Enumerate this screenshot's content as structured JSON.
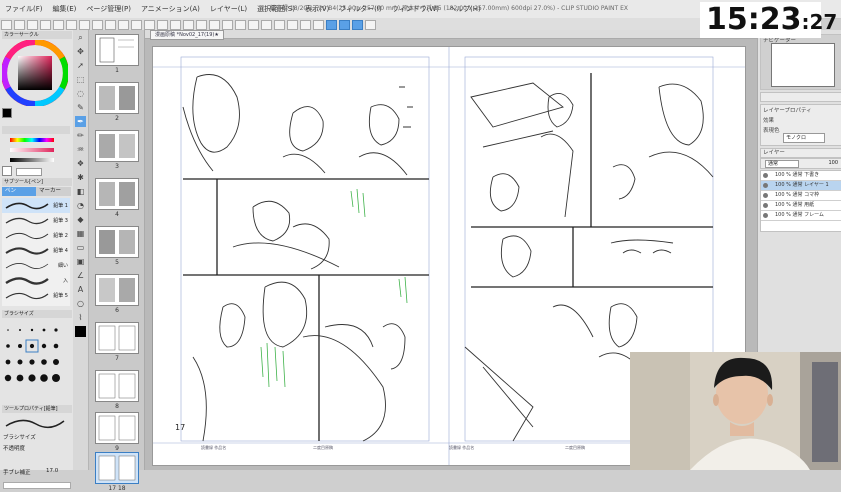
{
  "menubar": {
    "items": [
      "ファイル(F)",
      "編集(E)",
      "ページ管理(P)",
      "アニメーション(A)",
      "レイヤー(L)",
      "選択範囲(S)",
      "表示(V)",
      "フィルター(I)",
      "ウィンドウ(W)",
      "ヘルプ(H)"
    ],
    "doc_title": "読書録 18/20 17/20 B4(25.00 x 257.00 mm) 原本サイズ B5 (182.00 x 257.00mm) 600dpi 27.0%) - CLIP STUDIO PAINT EX"
  },
  "clock": {
    "hm": "15:23",
    "sec": ":27"
  },
  "canvas_tab": {
    "label": "漫画原稿 *Nov02_17(19)★"
  },
  "left_panel": {
    "sub_tool_header": "サブツール[ペン]",
    "pen_tab": "ペン",
    "marker_tab": "マーカー",
    "brushes": [
      "鉛筆 1",
      "鉛筆 3",
      "鉛筆 2",
      "鉛筆 4",
      "細い",
      "入",
      "鉛筆 5"
    ],
    "brush_size_header": "ブラシサイズ",
    "tool_property_header": "ツールプロパティ[鉛筆]",
    "brush_size_label": "ブラシサイズ",
    "brush_size_value": "17.0",
    "antialias_label": "不透明度",
    "stabilize_label": "手ブレ補正",
    "stabilize_value": "17.0",
    "brush_sizes": [
      "1",
      "1.5",
      "2",
      "2.5",
      "3",
      "4",
      "5",
      "6",
      "7",
      "8",
      "10",
      "12",
      "15",
      "17",
      "20",
      "25",
      "30",
      "40",
      "50",
      "60",
      "70",
      "80",
      "100",
      "120"
    ]
  },
  "pages": [
    {
      "num": "1",
      "active": false
    },
    {
      "num": "2",
      "active": false
    },
    {
      "num": "3",
      "active": false
    },
    {
      "num": "4",
      "active": false
    },
    {
      "num": "5",
      "active": false
    },
    {
      "num": "6",
      "active": false
    },
    {
      "num": "7",
      "active": false
    },
    {
      "num": "8",
      "active": false
    },
    {
      "num": "9",
      "active": false
    },
    {
      "num": "17 18",
      "active": true
    }
  ],
  "spread": {
    "page_number": "17",
    "margin_notes": [
      "読書録 作品名",
      "二度目原稿",
      "読書録 作品名",
      "二度目原稿"
    ]
  },
  "right_panel": {
    "navigator_label": "ナビゲーター",
    "layer_property_label": "レイヤープロパティ",
    "effect_label": "効果",
    "expression_color_label": "表現色",
    "expression_color_value": "モノクロ",
    "layer_panel_label": "レイヤー",
    "blend_mode": "通常",
    "opacity": "100",
    "layers": [
      {
        "name": "100 % 通常 下書き",
        "selected": false
      },
      {
        "name": "100 % 通常 レイヤー 1",
        "selected": true
      },
      {
        "name": "100 % 通常 コマ枠",
        "selected": false
      },
      {
        "name": "100 % 通常 用紙",
        "selected": false
      },
      {
        "name": "100 % 通常 フレーム",
        "selected": false
      }
    ]
  },
  "colors": {
    "accent": "#5aa0e6",
    "selected_layer": "#b9d4ef",
    "main_color": "#000000",
    "sub_color": "#ffffff"
  }
}
